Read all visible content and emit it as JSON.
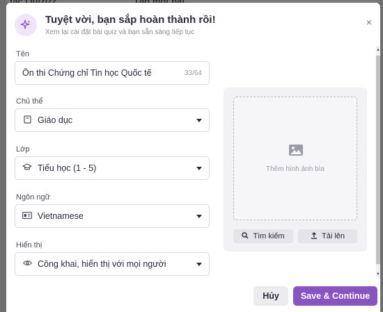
{
  "background": {
    "left_text": "tác Quizizz",
    "right_text": "Tạo một bài"
  },
  "header": {
    "title": "Tuyệt vời, bạn sắp hoàn thành rồi!",
    "subtitle": "Xem lại cài đặt bài quiz và bạn sẵn sàng tiếp tục",
    "icon": "sparkle-icon",
    "close": "×"
  },
  "form": {
    "name": {
      "label": "Tên",
      "value": "Ôn thi Chứng chỉ Tin học Quốc tế",
      "count": "33/64"
    },
    "subject": {
      "label": "Chủ thể",
      "value": "Giáo dục",
      "icon": "book-icon"
    },
    "grade": {
      "label": "Lớp",
      "value": "Tiểu học (1 - 5)",
      "icon": "graduation-cap-icon"
    },
    "language": {
      "label": "Ngôn ngữ",
      "value": "Vietnamese",
      "icon": "language-icon"
    },
    "visibility": {
      "label": "Hiển thị",
      "value": "Công khai, hiển thị với mọi người",
      "icon": "eye-icon"
    }
  },
  "cover": {
    "placeholder": "Thêm hình ảnh bìa",
    "search_label": "Tìm kiếm",
    "upload_label": "Tải lên"
  },
  "footer": {
    "cancel_label": "Hủy",
    "save_label": "Save & Continue"
  },
  "colors": {
    "accent": "#8854c0",
    "accent_light": "#efe6fb"
  }
}
